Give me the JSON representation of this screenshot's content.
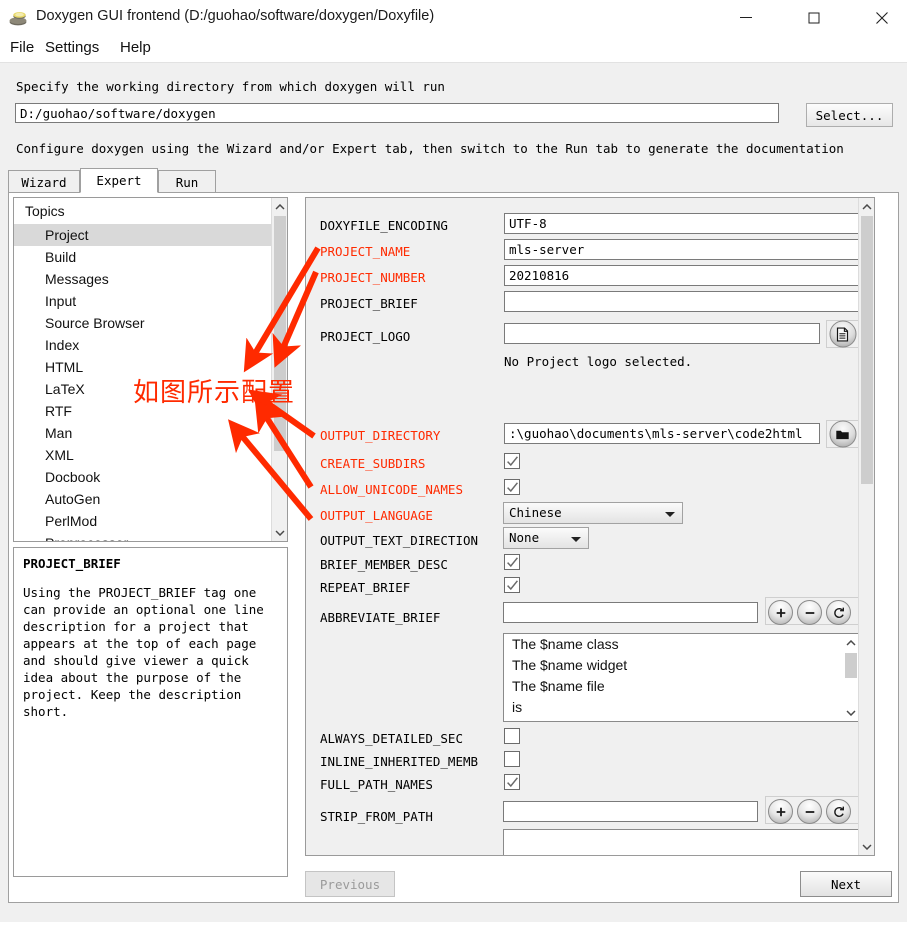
{
  "window": {
    "title": "Doxygen GUI frontend (D:/guohao/software/doxygen/Doxyfile)",
    "app_icon": "doxygen-icon",
    "controls": {
      "minimize": "minimize-icon",
      "maximize": "maximize-icon",
      "close": "close-icon"
    }
  },
  "menubar": {
    "items": [
      "File",
      "Settings",
      "Help"
    ]
  },
  "workdir": {
    "hint": "Specify the working directory from which doxygen will run",
    "value": "D:/guohao/software/doxygen",
    "placeholder": "",
    "select_label": "Select..."
  },
  "configure_hint": "Configure doxygen using the Wizard and/or Expert tab, then switch to the Run tab to generate the documentation",
  "tabs": [
    {
      "label": "Wizard",
      "active": false
    },
    {
      "label": "Expert",
      "active": true
    },
    {
      "label": "Run",
      "active": false
    }
  ],
  "topics": {
    "header": "Topics",
    "selected": "Project",
    "items": [
      "Project",
      "Build",
      "Messages",
      "Input",
      "Source Browser",
      "Index",
      "HTML",
      "LaTeX",
      "RTF",
      "Man",
      "XML",
      "Docbook",
      "AutoGen",
      "PerlMod",
      "Preprocessor"
    ]
  },
  "help": {
    "title": "PROJECT_BRIEF",
    "body": "Using the PROJECT_BRIEF tag one can provide an optional one line description for a project that appears at the top of each page and should give viewer a quick idea about the purpose of the project. Keep the description short."
  },
  "settings": {
    "doxyfile_encoding": {
      "label": "DOXYFILE_ENCODING",
      "value": "UTF-8",
      "highlight": false
    },
    "project_name": {
      "label": "PROJECT_NAME",
      "value": "mls-server",
      "highlight": true
    },
    "project_number": {
      "label": "PROJECT_NUMBER",
      "value": "20210816",
      "highlight": true
    },
    "project_brief": {
      "label": "PROJECT_BRIEF",
      "value": "",
      "highlight": false
    },
    "project_logo": {
      "label": "PROJECT_LOGO",
      "value": "",
      "highlight": false,
      "browse_icon": "file-icon"
    },
    "project_logo_note": "No Project logo selected.",
    "output_directory": {
      "label": "OUTPUT_DIRECTORY",
      "value": ":\\guohao\\documents\\mls-server\\code2html",
      "highlight": true,
      "browse_icon": "folder-icon"
    },
    "create_subdirs": {
      "label": "CREATE_SUBDIRS",
      "checked": true,
      "highlight": true
    },
    "allow_unicode_names": {
      "label": "ALLOW_UNICODE_NAMES",
      "checked": true,
      "highlight": true
    },
    "output_language": {
      "label": "OUTPUT_LANGUAGE",
      "value": "Chinese",
      "highlight": true
    },
    "output_text_direction": {
      "label": "OUTPUT_TEXT_DIRECTION",
      "value": "None",
      "highlight": false
    },
    "brief_member_desc": {
      "label": "BRIEF_MEMBER_DESC",
      "checked": true,
      "highlight": false
    },
    "repeat_brief": {
      "label": "REPEAT_BRIEF",
      "checked": true,
      "highlight": false
    },
    "abbreviate_brief": {
      "label": "ABBREVIATE_BRIEF",
      "value": "",
      "highlight": false,
      "list": [
        "The $name class",
        "The $name widget",
        "The $name file",
        "is"
      ]
    },
    "always_detailed_sec": {
      "label": "ALWAYS_DETAILED_SEC",
      "checked": false,
      "highlight": false
    },
    "inline_inherited_memb": {
      "label": "INLINE_INHERITED_MEMB",
      "checked": false,
      "highlight": false
    },
    "full_path_names": {
      "label": "FULL_PATH_NAMES",
      "checked": true,
      "highlight": false
    },
    "strip_from_path": {
      "label": "STRIP_FROM_PATH",
      "value": "",
      "highlight": false
    },
    "list_buttons": {
      "add": "plus-icon",
      "remove": "minus-icon",
      "refresh": "refresh-icon"
    }
  },
  "footer": {
    "previous_label": "Previous",
    "next_label": "Next"
  },
  "annotation": {
    "text": "如图所示配置",
    "color": "#ff2a00",
    "arrow_count": 5
  },
  "colors": {
    "highlight": "#ff2a00",
    "window_bg": "#f0f0f0",
    "panel_bg": "#ffffff",
    "selection": "#d9d9d9"
  }
}
